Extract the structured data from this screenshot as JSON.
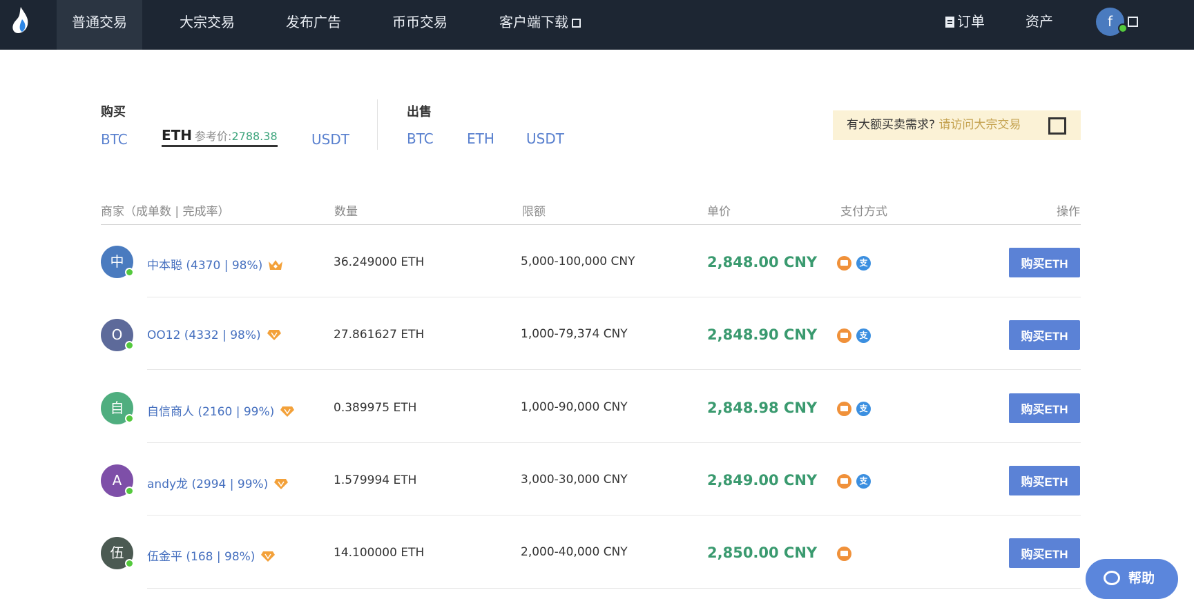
{
  "nav": {
    "items": [
      {
        "label": "普通交易"
      },
      {
        "label": "大宗交易"
      },
      {
        "label": "发布广告"
      },
      {
        "label": "币币交易"
      },
      {
        "label": "客户端下载"
      }
    ],
    "orders_label": "订单",
    "assets_label": "资产",
    "user_initial": "f"
  },
  "tabs": {
    "buy_label": "购买",
    "sell_label": "出售",
    "buy_coins": [
      "BTC",
      "ETH",
      "USDT"
    ],
    "sell_coins": [
      "BTC",
      "ETH",
      "USDT"
    ],
    "ref_price_label": "参考价:",
    "ref_price_value": "2788.38"
  },
  "bulk_banner": {
    "text": "有大额买卖需求?",
    "link": "请访问大宗交易"
  },
  "table": {
    "headers": {
      "merchant": "商家（成单数 | 完成率）",
      "quantity": "数量",
      "limit": "限额",
      "price": "单价",
      "payment": "支付方式",
      "action": "操作"
    },
    "rows": [
      {
        "initial": "中",
        "merchant": "中本聪 (4370 | 98%)",
        "quantity": "36.249000 ETH",
        "limit": "5,000-100,000 CNY",
        "price": "2,848.00 CNY",
        "button": "购买ETH",
        "avatar_color": "#4a7bbf",
        "badge": "crown-icon"
      },
      {
        "initial": "O",
        "merchant": "OO12 (4332 | 98%)",
        "quantity": "27.861627 ETH",
        "limit": "1,000-79,374 CNY",
        "price": "2,848.90 CNY",
        "button": "购买ETH",
        "avatar_color": "#5d6a9a",
        "badge": "diamond-icon"
      },
      {
        "initial": "自",
        "merchant": "自信商人 (2160 | 99%)",
        "quantity": "0.389975 ETH",
        "limit": "1,000-90,000 CNY",
        "price": "2,848.98 CNY",
        "button": "购买ETH",
        "avatar_color": "#4fae7f",
        "badge": "diamond-icon"
      },
      {
        "initial": "A",
        "merchant": "andy龙 (2994 | 99%)",
        "quantity": "1.579994 ETH",
        "limit": "3,000-30,000 CNY",
        "price": "2,849.00 CNY",
        "button": "购买ETH",
        "avatar_color": "#7e4fa8",
        "badge": "diamond-icon"
      },
      {
        "initial": "伍",
        "merchant": "伍金平 (168 | 98%)",
        "quantity": "14.100000 ETH",
        "limit": "2,000-40,000 CNY",
        "price": "2,850.00 CNY",
        "button": "购买ETH",
        "avatar_color": "#4b5a52",
        "badge": "diamond-icon"
      }
    ],
    "alipay_glyph": "支"
  },
  "help_label": "帮助"
}
